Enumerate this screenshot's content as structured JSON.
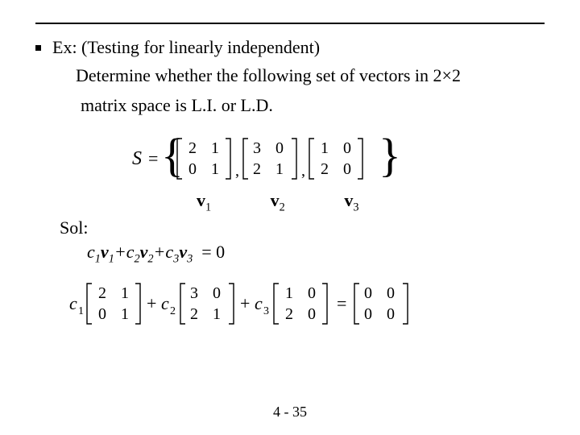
{
  "ex_label": "Ex: (Testing for linearly independent)",
  "determine1": "Determine whether the following set of vectors in 2×2",
  "determine2": "matrix space  is L.I. or L.D.",
  "set": {
    "S": "S",
    "matrices": [
      {
        "a": "2",
        "b": "1",
        "c": "0",
        "d": "1"
      },
      {
        "a": "3",
        "b": "0",
        "c": "2",
        "d": "1"
      },
      {
        "a": "1",
        "b": "0",
        "c": "2",
        "d": "0"
      }
    ]
  },
  "vlabels": {
    "v": "v",
    "subs": [
      "1",
      "2",
      "3"
    ]
  },
  "sol_label": "Sol:",
  "comb": {
    "c": "c",
    "v": "v",
    "idx": [
      "1",
      "2",
      "3"
    ],
    "eq_rhs": "= 0"
  },
  "expanded": {
    "c": "c",
    "matrices": [
      {
        "a": "2",
        "b": "1",
        "c": "0",
        "d": "1"
      },
      {
        "a": "3",
        "b": "0",
        "c": "2",
        "d": "1"
      },
      {
        "a": "1",
        "b": "0",
        "c": "2",
        "d": "0"
      }
    ],
    "zero": {
      "a": "0",
      "b": "0",
      "c": "0",
      "d": "0"
    }
  },
  "pagenum": "4 - 35"
}
